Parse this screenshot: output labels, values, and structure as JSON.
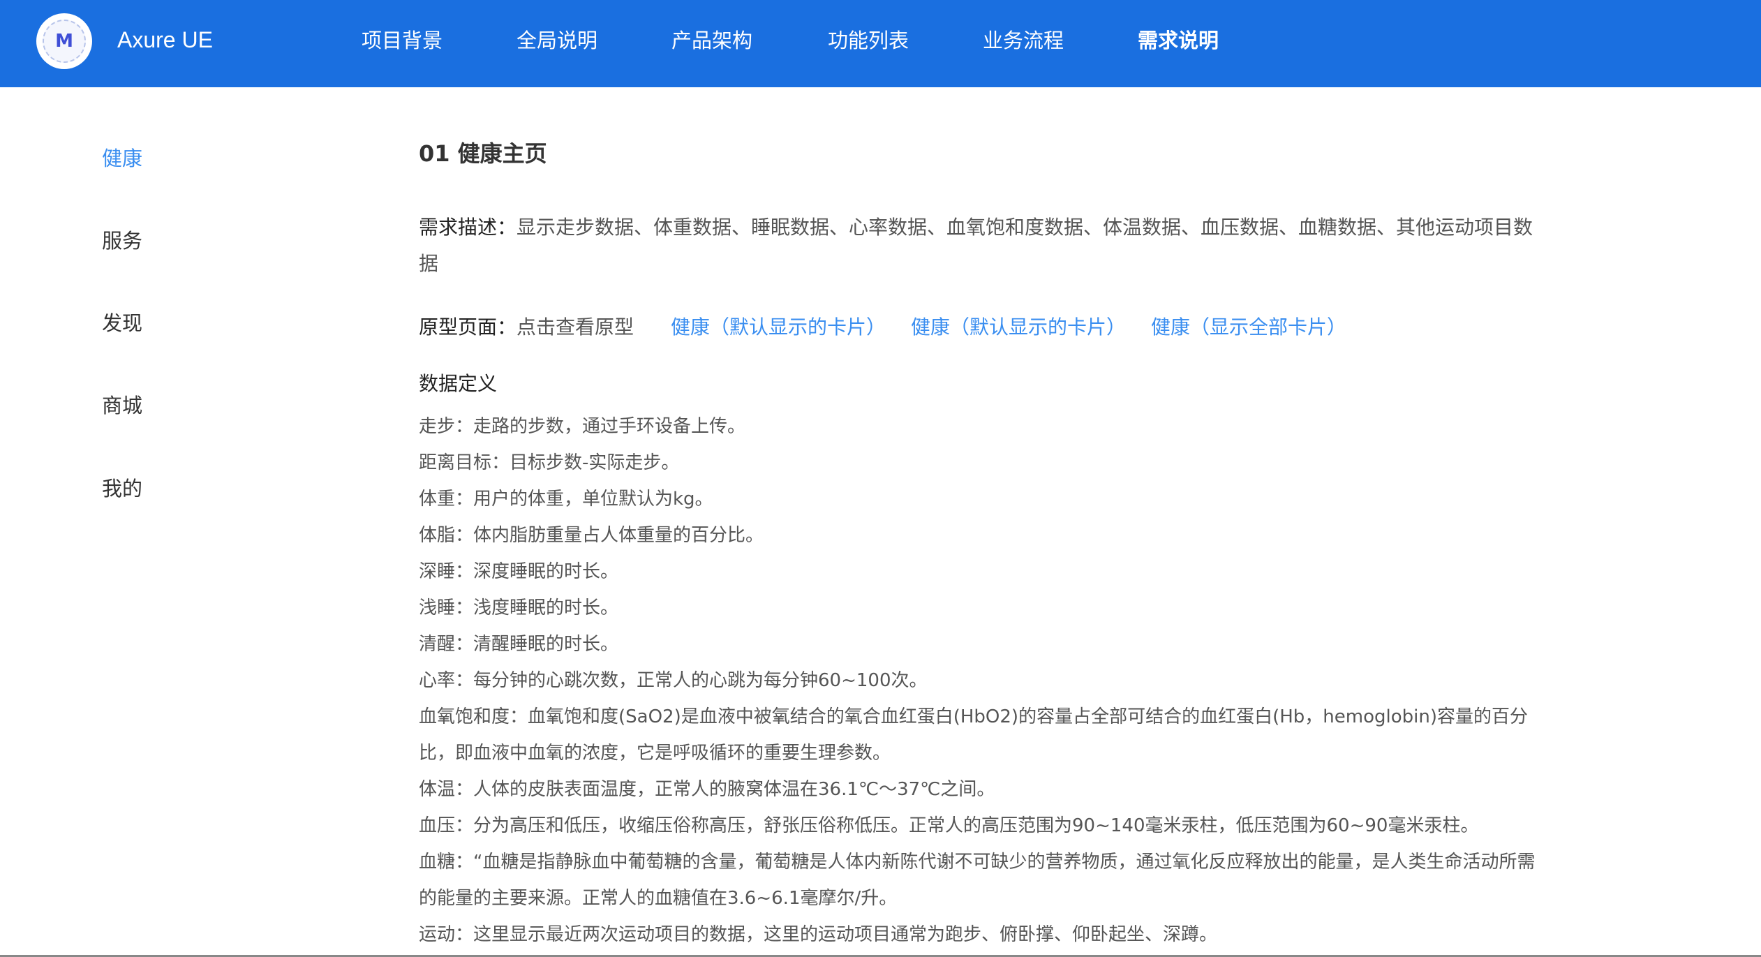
{
  "header": {
    "brand": "Axure UE",
    "logo_letter": "M",
    "accent_color": "#1a6fe0",
    "nav": [
      {
        "label": "项目背景",
        "active": false
      },
      {
        "label": "全局说明",
        "active": false
      },
      {
        "label": "产品架构",
        "active": false
      },
      {
        "label": "功能列表",
        "active": false
      },
      {
        "label": "业务流程",
        "active": false
      },
      {
        "label": "需求说明",
        "active": true
      }
    ]
  },
  "sidebar": {
    "items": [
      {
        "label": "健康",
        "active": true
      },
      {
        "label": "服务",
        "active": false
      },
      {
        "label": "发现",
        "active": false
      },
      {
        "label": "商城",
        "active": false
      },
      {
        "label": "我的",
        "active": false
      }
    ]
  },
  "main": {
    "title": "01 健康主页",
    "req_desc_label": "需求描述：",
    "req_desc_text": "显示走步数据、体重数据、睡眠数据、心率数据、血氧饱和度数据、体温数据、血压数据、血糖数据、其他运动项目数据",
    "proto_label": "原型页面：",
    "proto_hint": "点击查看原型",
    "proto_links": [
      "健康（默认显示的卡片）",
      "健康（默认显示的卡片）",
      "健康（显示全部卡片）"
    ],
    "data_def_title": "数据定义",
    "definitions": [
      "走步：走路的步数，通过手环设备上传。",
      "距离目标：目标步数-实际走步。",
      "体重：用户的体重，单位默认为kg。",
      "体脂：体内脂肪重量占人体重量的百分比。",
      "深睡：深度睡眠的时长。",
      "浅睡：浅度睡眠的时长。",
      "清醒：清醒睡眠的时长。",
      "心率：每分钟的心跳次数，正常人的心跳为每分钟60~100次。",
      "血氧饱和度：血氧饱和度(SaO2)是血液中被氧结合的氧合血红蛋白(HbO2)的容量占全部可结合的血红蛋白(Hb，hemoglobin)容量的百分比，即血液中血氧的浓度，它是呼吸循环的重要生理参数。",
      "体温：人体的皮肤表面温度，正常人的腋窝体温在36.1℃～37℃之间。",
      "血压：分为高压和低压，收缩压俗称高压，舒张压俗称低压。正常人的高压范围为90~140毫米汞柱，低压范围为60~90毫米汞柱。",
      "血糖：“血糖是指静脉血中葡萄糖的含量，葡萄糖是人体内新陈代谢不可缺少的营养物质，通过氧化反应释放出的能量，是人类生命活动所需的能量的主要来源。正常人的血糖值在3.6~6.1毫摩尔/升。",
      "运动：这里显示最近两次运动项目的数据，这里的运动项目通常为跑步、俯卧撑、仰卧起坐、深蹲。"
    ]
  }
}
